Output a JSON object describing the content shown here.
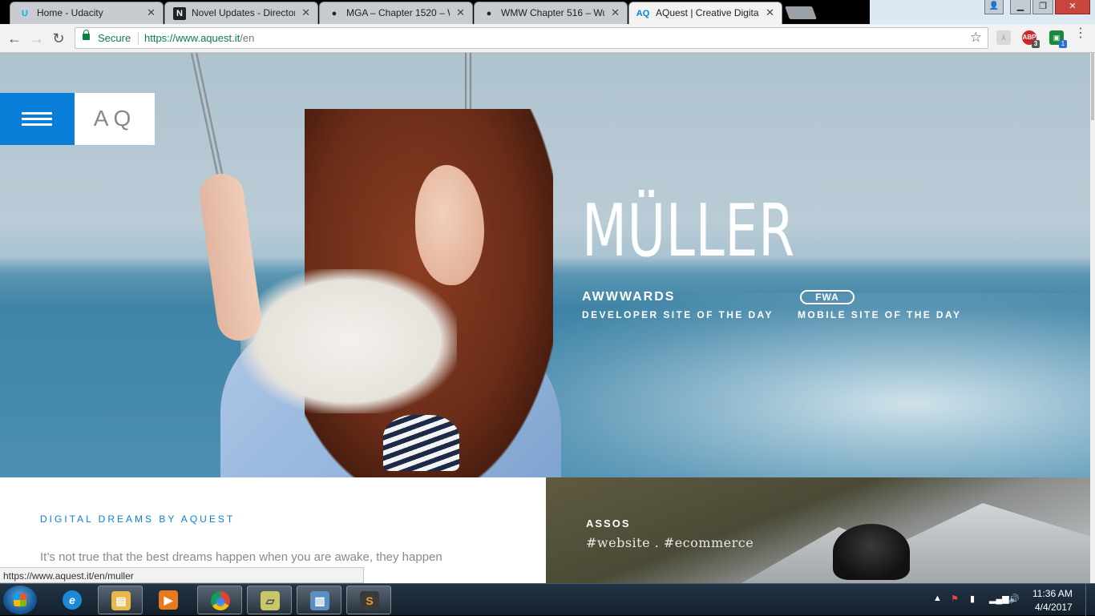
{
  "browser": {
    "tabs": [
      {
        "favicon": "U",
        "title": "Home - Udacity",
        "active": false
      },
      {
        "favicon": "N",
        "title": "Novel Updates - Director",
        "active": false
      },
      {
        "favicon": "●",
        "title": "MGA – Chapter 1520 – W",
        "active": false
      },
      {
        "favicon": "●",
        "title": "WMW Chapter 516 – Wu",
        "active": false
      },
      {
        "favicon": "AQ",
        "title": "AQuest | Creative Digital",
        "active": true
      }
    ],
    "close_glyph": "✕",
    "address": {
      "secure_label": "Secure",
      "url_host": "https://www.aquest.it",
      "url_path": "/en"
    },
    "extensions": [
      {
        "name": "pdf-extension-icon",
        "label": "⅄",
        "badge": ""
      },
      {
        "name": "adblock-plus-icon",
        "label": "ABP",
        "badge": "3"
      },
      {
        "name": "green-extension-icon",
        "label": "▣",
        "badge": "1"
      }
    ],
    "status_bar_url": "https://www.aquest.it/en/muller"
  },
  "site": {
    "logo": "AQ",
    "hero": {
      "title": "MÜLLER",
      "award1_name": "AWWWARDS",
      "award1_sub": "DEVELOPER SITE OF THE DAY",
      "award2_logo": "FWA",
      "award2_sub": "MOBILE SITE OF THE DAY"
    },
    "intro": {
      "title": "DIGITAL DREAMS BY AQUEST",
      "text": "It’s not true that the best dreams happen when you are awake, they happen"
    },
    "project": {
      "name": "ASSOS",
      "tags": "#website . #ecommerce"
    }
  },
  "taskbar": {
    "clock_time": "11:36 AM",
    "clock_date": "4/4/2017",
    "apps": [
      {
        "name": "internet-explorer-icon",
        "glyph": "e",
        "color": "#1e88d8",
        "open": false
      },
      {
        "name": "file-explorer-icon",
        "glyph": "▤",
        "color": "#e8b84a",
        "open": true
      },
      {
        "name": "media-player-icon",
        "glyph": "▶",
        "color": "#e87a1e",
        "open": false
      },
      {
        "name": "chrome-icon",
        "glyph": "◉",
        "color": "#dd4b39",
        "open": true
      },
      {
        "name": "sticky-notes-icon",
        "glyph": "▱",
        "color": "#c8c86a",
        "open": true
      },
      {
        "name": "computer-icon",
        "glyph": "▥",
        "color": "#5a8fc2",
        "open": true
      },
      {
        "name": "sublime-text-icon",
        "glyph": "S",
        "color": "#f29a2e",
        "open": true
      }
    ]
  }
}
